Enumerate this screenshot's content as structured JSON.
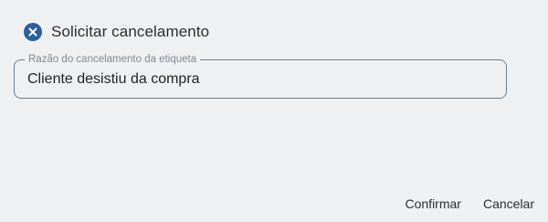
{
  "dialog": {
    "title": "Solicitar cancelamento",
    "close_icon": "close-circle-icon",
    "accent_color": "#2f5f9a"
  },
  "reason_field": {
    "label": "Razão do cancelamento da etiqueta",
    "value": "Cliente desistiu da compra"
  },
  "actions": {
    "confirm_label": "Confirmar",
    "cancel_label": "Cancelar"
  }
}
